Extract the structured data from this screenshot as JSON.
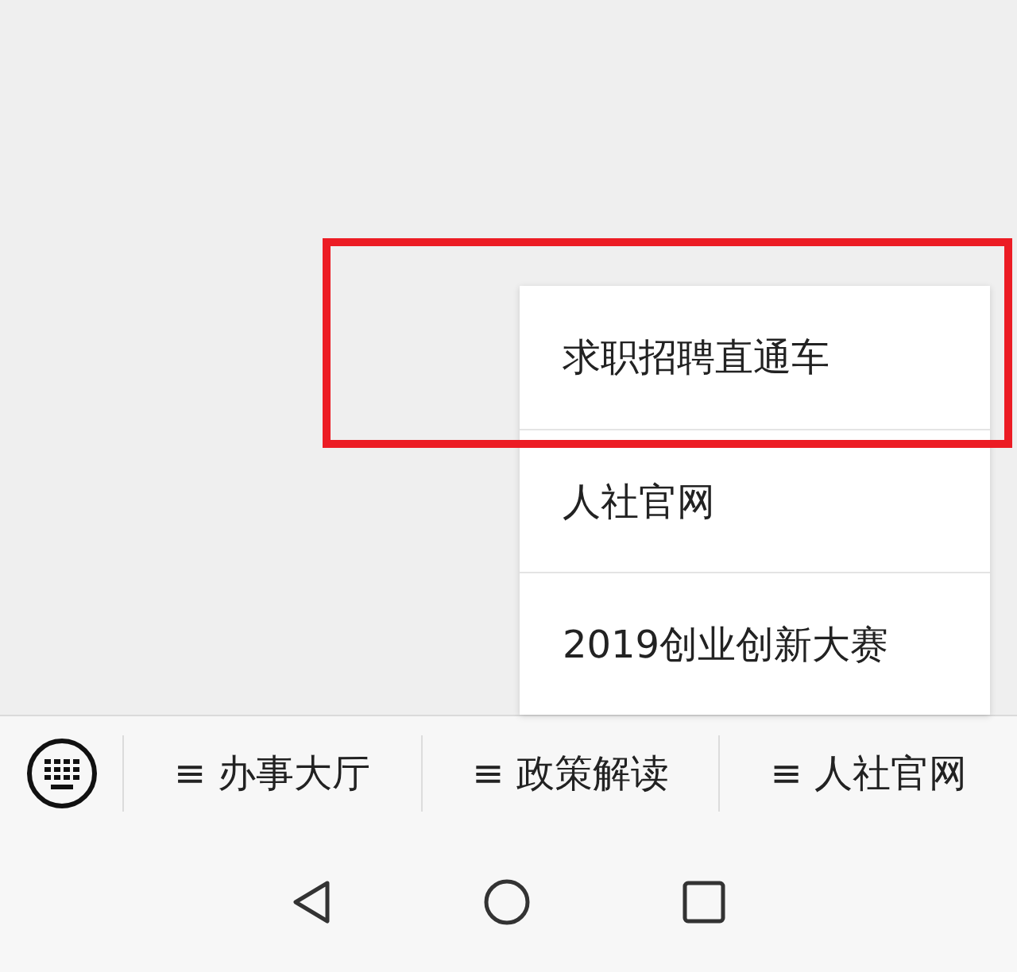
{
  "popup_menu": {
    "items": [
      {
        "label": "求职招聘直通车",
        "highlighted": true
      },
      {
        "label": "人社官网",
        "highlighted": false
      },
      {
        "label": "2019创业创新大赛",
        "highlighted": false
      }
    ]
  },
  "bottom_menu": {
    "items": [
      {
        "label": "≡ 办事大厅"
      },
      {
        "label": "≡ 政策解读"
      },
      {
        "label": "≡ 人社官网"
      }
    ]
  }
}
